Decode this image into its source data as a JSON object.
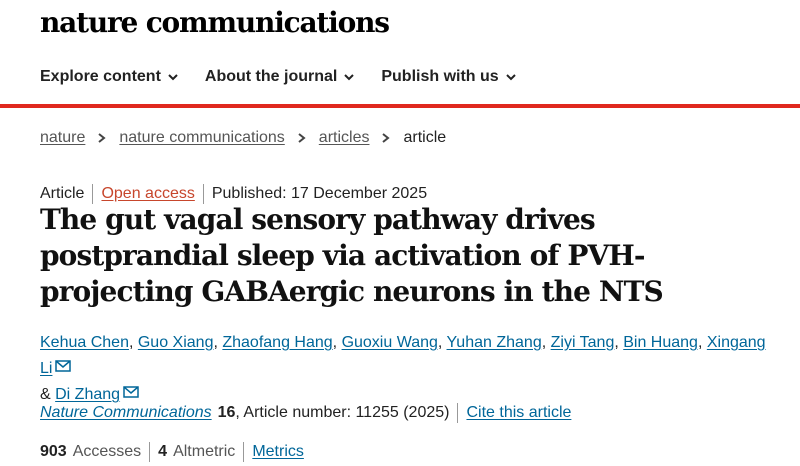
{
  "header": {
    "brand": "nature communications",
    "nav": [
      {
        "label": "Explore content"
      },
      {
        "label": "About the journal"
      },
      {
        "label": "Publish with us"
      }
    ]
  },
  "breadcrumb": [
    "nature",
    "nature communications",
    "articles",
    "article"
  ],
  "meta": {
    "type": "Article",
    "access": "Open access",
    "published": "Published: 17 December 2025"
  },
  "title": "The gut vagal sensory pathway drives postprandial sleep via activation of PVH-projecting GABAergic neurons in the NTS",
  "authors": [
    {
      "name": "Kehua Chen",
      "sep": ", "
    },
    {
      "name": "Guo Xiang",
      "sep": ", "
    },
    {
      "name": "Zhaofang Hang",
      "sep": ", "
    },
    {
      "name": "Guoxiu Wang",
      "sep": ", "
    },
    {
      "name": "Yuhan Zhang",
      "sep": ", "
    },
    {
      "name": "Ziyi Tang",
      "sep": ", "
    },
    {
      "name": "Bin Huang",
      "sep": ", "
    },
    {
      "name": "Xingang Li",
      "sep": " ",
      "corresponding": true
    },
    {
      "name": "Di Zhang",
      "sep": "",
      "corresponding": true,
      "prefix": "& "
    }
  ],
  "citation": {
    "journal": "Nature Communications",
    "volume": "16",
    "article_number": ", Article number: 11255 (2025)",
    "cite_link": "Cite this article"
  },
  "metrics": {
    "accesses_value": "903",
    "accesses_label": "Accesses",
    "altmetric_value": "4",
    "altmetric_label": "Altmetric",
    "metrics_link": "Metrics"
  },
  "colors": {
    "accent_red": "#e0281e",
    "link_blue": "#006699",
    "open_access": "#c7462c"
  }
}
